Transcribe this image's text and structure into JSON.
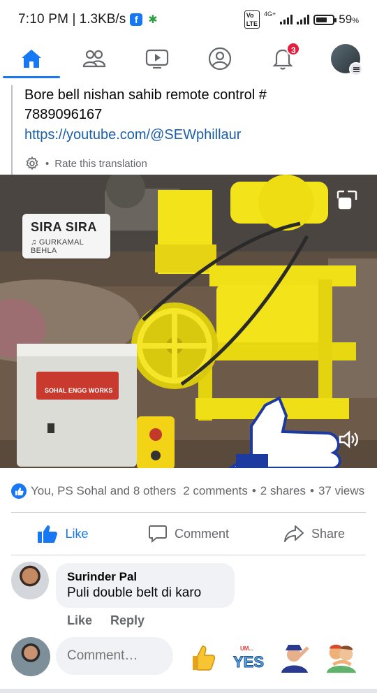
{
  "status_bar": {
    "time": "7:10 PM",
    "speed": "1.3KB/s",
    "network": "4G+",
    "battery": "59",
    "battery_unit": "%"
  },
  "nav": {
    "items": [
      {
        "name": "home",
        "active": true
      },
      {
        "name": "friends",
        "active": false
      },
      {
        "name": "watch",
        "active": false
      },
      {
        "name": "profile",
        "active": false
      },
      {
        "name": "notifications",
        "active": false,
        "badge": "3"
      },
      {
        "name": "menu",
        "active": false
      }
    ]
  },
  "post": {
    "text_line1": "Bore bell nishan sahib remote control #",
    "text_line2": "7889096167",
    "link": "https://youtube.com/@SEWphillaur",
    "rate_translation": "Rate this translation"
  },
  "media": {
    "song": "SIRA SIRA",
    "artist": "GURKAMAL BEHLA",
    "box_label": "SOHAL ENGG WORKS"
  },
  "reactions": {
    "people": "You, PS Sohal and 8 others",
    "comments": "2 comments",
    "shares": "2 shares",
    "views": "37 views"
  },
  "actions": {
    "like": "Like",
    "comment": "Comment",
    "share": "Share"
  },
  "comment": {
    "author": "Surinder Pal",
    "text": "Puli double belt di karo",
    "like": "Like",
    "reply": "Reply"
  },
  "compose": {
    "placeholder": "Comment…",
    "sticker_yes": "YES",
    "sticker_um": "UM..."
  },
  "colors": {
    "accent": "#1877f2",
    "badge": "#e41e3f",
    "machine_yellow": "#f2e31a"
  }
}
